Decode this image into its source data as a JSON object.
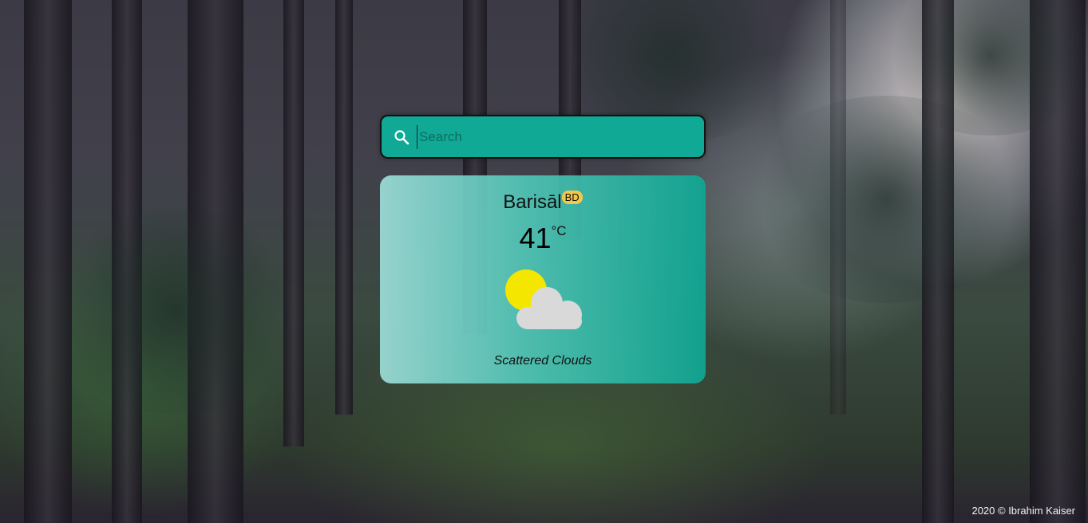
{
  "search": {
    "placeholder": "Search",
    "value": ""
  },
  "weather": {
    "city": "Barisāl",
    "country": "BD",
    "temperature": "41",
    "unit": "°C",
    "description": "Scattered Clouds",
    "icon": "sun-behind-cloud-icon"
  },
  "footer": {
    "text": "2020 © Ibrahim Kaiser"
  },
  "colors": {
    "accent": "#10a995",
    "badge": "#f3c84a",
    "sun": "#f5e600",
    "cloud": "#d9d9d9"
  }
}
